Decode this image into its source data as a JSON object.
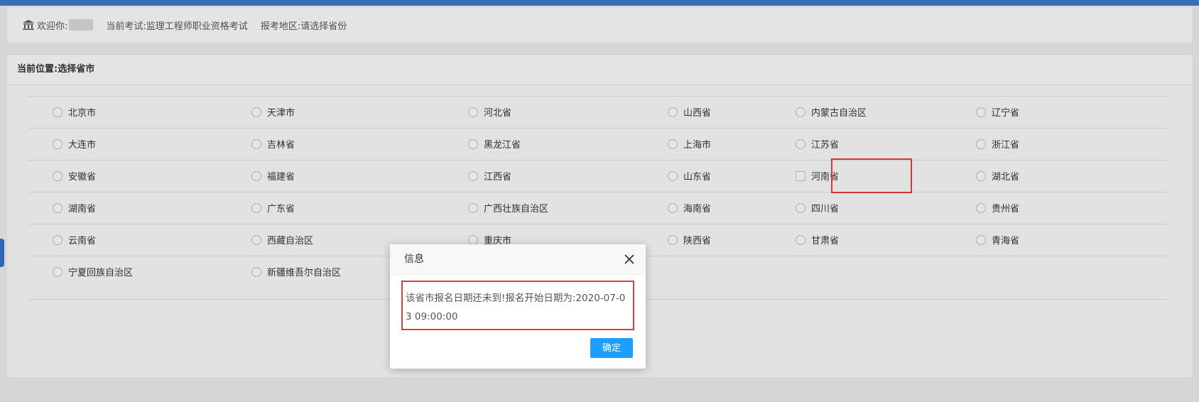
{
  "header": {
    "welcome_label": "欢迎你:",
    "exam_label": "当前考试:",
    "exam_value": "监理工程师职业资格考试",
    "region_label": "报考地区:",
    "region_value": "请选择省份"
  },
  "panel": {
    "title": "当前位置:选择省市"
  },
  "provinces": [
    [
      "北京市",
      "天津市",
      "河北省",
      "山西省",
      "内蒙古自治区",
      "辽宁省"
    ],
    [
      "大连市",
      "吉林省",
      "黑龙江省",
      "上海市",
      "江苏省",
      "浙江省"
    ],
    [
      "安徽省",
      "福建省",
      "江西省",
      "山东省",
      "河南省",
      "湖北省"
    ],
    [
      "湖南省",
      "广东省",
      "广西壮族自治区",
      "海南省",
      "四川省",
      "贵州省"
    ],
    [
      "云南省",
      "西藏自治区",
      "重庆市",
      "陕西省",
      "甘肃省",
      "青海省"
    ],
    [
      "宁夏回族自治区",
      "新疆维吾尔自治区",
      "",
      "",
      "",
      ""
    ]
  ],
  "dialog": {
    "title": "信息",
    "message": "该省市报名日期还未到!报名开始日期为:2020-07-03 09:00:00",
    "ok_label": "确定"
  },
  "colors": {
    "topbar": "#3a76c4",
    "highlight": "#e03c3c",
    "ok_button": "#1e9fff"
  },
  "icons": {
    "bank": "bank-icon",
    "close": "close-icon"
  }
}
